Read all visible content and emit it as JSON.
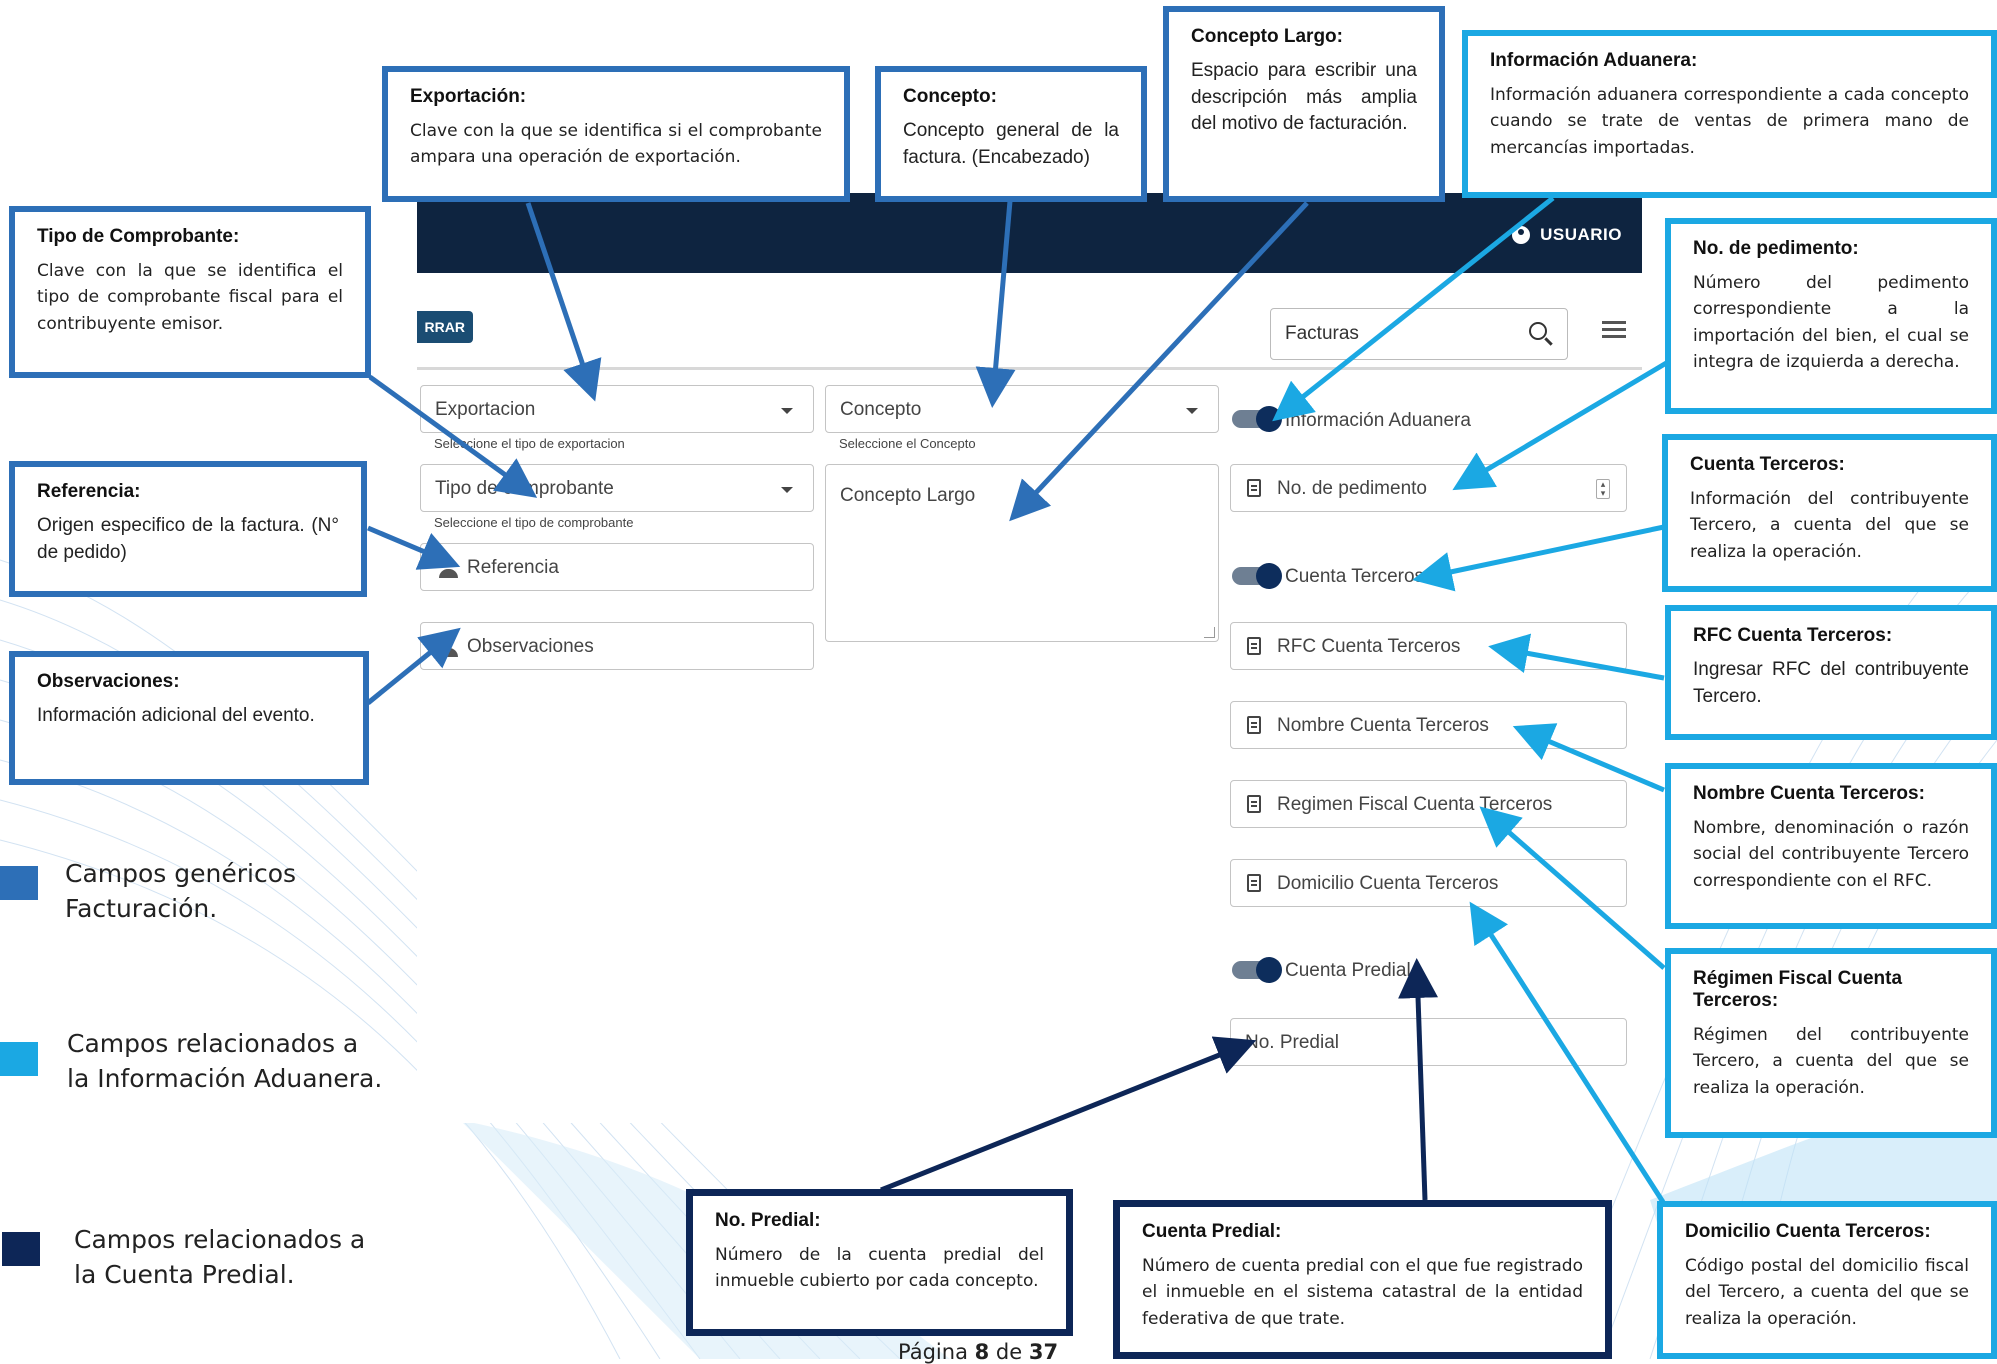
{
  "app": {
    "user_label": "USUARIO",
    "close_button": "RRAR",
    "search_value": "Facturas",
    "fields": {
      "exportacion": {
        "label": "Exportacion",
        "helper": "Seleccione el tipo de exportacion"
      },
      "tipo_comprobante": {
        "label": "Tipo de comprobante",
        "helper": "Seleccione el tipo de comprobante"
      },
      "referencia": {
        "label": "Referencia"
      },
      "observaciones": {
        "label": "Observaciones"
      },
      "concepto": {
        "label": "Concepto",
        "helper": "Seleccione el Concepto"
      },
      "concepto_largo": {
        "label": "Concepto Largo"
      },
      "info_aduanera_toggle": "Información Aduanera",
      "no_pedimento": "No. de pedimento",
      "cuenta_terceros_toggle": "Cuenta Terceros",
      "rfc_cuenta_terceros": "RFC Cuenta Terceros",
      "nombre_cuenta_terceros": "Nombre Cuenta Terceros",
      "regimen_fiscal_cuenta_terceros": "Regimen Fiscal Cuenta Terceros",
      "domicilio_cuenta_terceros": "Domicilio Cuenta Terceros",
      "cuenta_predial_toggle": "Cuenta Predial",
      "no_predial": "No. Predial"
    }
  },
  "callouts": {
    "exportacion": {
      "title": "Exportación:",
      "text": "Clave con la que se identifica si el comprobante ampara una operación de exportación."
    },
    "concepto": {
      "title": "Concepto:",
      "text": "Concepto general de la factura. (Encabezado)"
    },
    "concepto_largo": {
      "title": "Concepto Largo:",
      "text": "Espacio para escribir una descripción más amplia del motivo de facturación."
    },
    "info_aduanera": {
      "title": "Información Aduanera:",
      "text": "Información aduanera correspondiente a cada concepto cuando se trate de ventas de primera mano de mercancías importadas."
    },
    "tipo_comprobante": {
      "title": "Tipo de Comprobante:",
      "text": "Clave con la que se identifica el tipo de comprobante fiscal para el contribuyente emisor."
    },
    "referencia": {
      "title": "Referencia:",
      "text": "Origen especifico de la factura. (N° de pedido)"
    },
    "observaciones": {
      "title": "Observaciones:",
      "text": "Información adicional del evento."
    },
    "no_pedimento": {
      "title": "No. de pedimento:",
      "text": "Número del pedimento correspondiente a la importación del bien, el cual se integra de izquierda a derecha."
    },
    "cuenta_terceros": {
      "title": "Cuenta Terceros:",
      "text": "Información del contribuyente Tercero, a cuenta del que se realiza la operación."
    },
    "rfc_cuenta_terceros": {
      "title": "RFC Cuenta Terceros:",
      "text": "Ingresar RFC del contribuyente Tercero."
    },
    "nombre_cuenta_terceros": {
      "title": "Nombre Cuenta Terceros:",
      "text": "Nombre, denominación o razón social del contribuyente Tercero correspondiente con el RFC."
    },
    "regimen_fiscal": {
      "title": "Régimen Fiscal Cuenta Terceros:",
      "text": "Régimen del contribuyente Tercero, a cuenta del que se realiza la operación."
    },
    "domicilio_cuenta_terceros": {
      "title": "Domicilio Cuenta Terceros:",
      "text": "Código postal del domicilio fiscal del Tercero, a cuenta del que se realiza la operación."
    },
    "no_predial": {
      "title": "No. Predial:",
      "text": "Número de la cuenta predial del inmueble cubierto por cada concepto."
    },
    "cuenta_predial": {
      "title": "Cuenta Predial:",
      "text": "Número de cuenta predial con el que fue registrado el inmueble en el sistema catastral de la entidad federativa de que trate."
    }
  },
  "legend": [
    {
      "label": "Campos genéricos Facturación.",
      "color": "#2d6fb7"
    },
    {
      "label": "Campos relacionados a la Información Aduanera.",
      "color": "#1ba8e3"
    },
    {
      "label": "Campos relacionados a la Cuenta Predial.",
      "color": "#0d2657"
    }
  ],
  "footer": {
    "page_prefix": "Página ",
    "page_current": "8",
    "page_sep": " de ",
    "page_total": "37"
  },
  "colors": {
    "generic": "#2d6fb7",
    "aduanera": "#1ba8e3",
    "predial": "#0d2657",
    "appbar": "#0e2440"
  }
}
